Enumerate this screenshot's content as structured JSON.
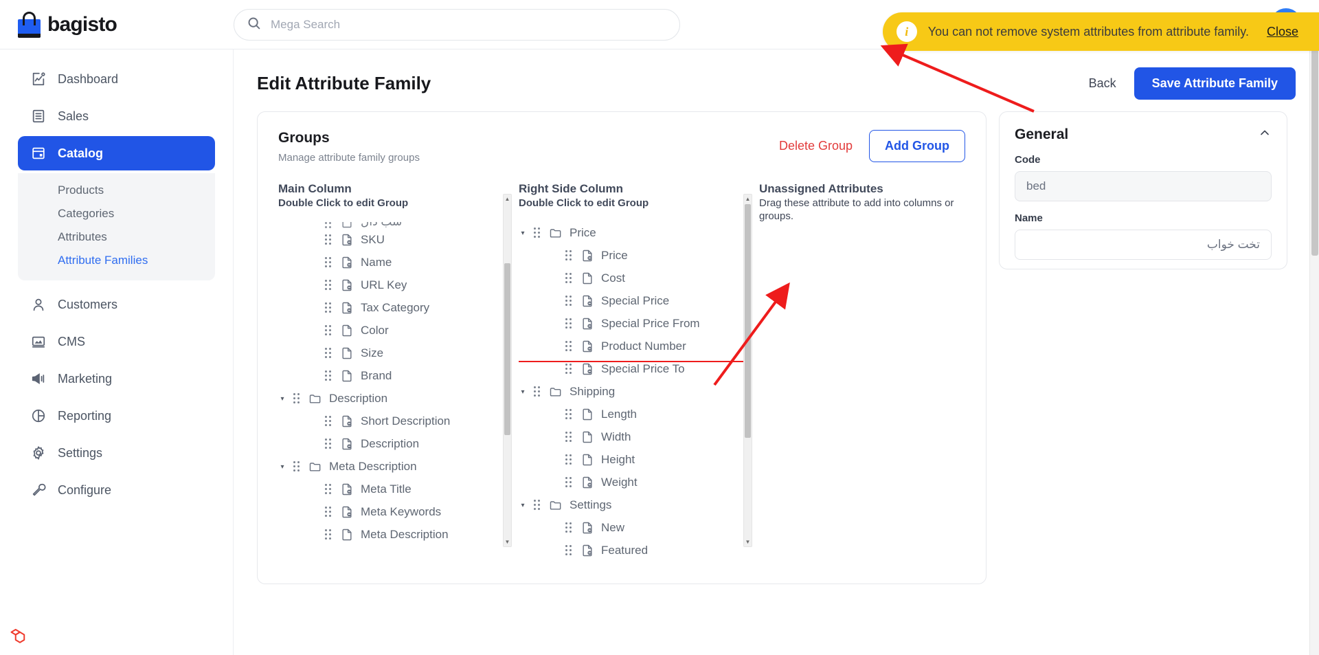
{
  "app": {
    "brand_name": "bagisto",
    "brand_color": "#1f5df1"
  },
  "search": {
    "placeholder": "Mega Search",
    "value": "",
    "icon": "search-icon"
  },
  "toast": {
    "icon": "info-icon",
    "message": "You can not remove system attributes from attribute family.",
    "close_label": "Close",
    "background": "#f7c916"
  },
  "sidebar": {
    "items": [
      {
        "label": "Dashboard",
        "icon": "dashboard-icon",
        "active": false
      },
      {
        "label": "Sales",
        "icon": "sales-icon",
        "active": false
      },
      {
        "label": "Catalog",
        "icon": "catalog-icon",
        "active": true
      },
      {
        "label": "Customers",
        "icon": "customers-icon",
        "active": false
      },
      {
        "label": "CMS",
        "icon": "cms-icon",
        "active": false
      },
      {
        "label": "Marketing",
        "icon": "marketing-icon",
        "active": false
      },
      {
        "label": "Reporting",
        "icon": "reporting-icon",
        "active": false
      },
      {
        "label": "Settings",
        "icon": "gear-icon",
        "active": false
      },
      {
        "label": "Configure",
        "icon": "wrench-icon",
        "active": false
      }
    ],
    "catalog_subitems": [
      {
        "label": "Products",
        "current": false
      },
      {
        "label": "Categories",
        "current": false
      },
      {
        "label": "Attributes",
        "current": false
      },
      {
        "label": "Attribute Families",
        "current": true
      }
    ]
  },
  "page": {
    "title": "Edit Attribute Family",
    "back_label": "Back",
    "save_label": "Save Attribute Family"
  },
  "groups": {
    "title": "Groups",
    "subtitle": "Manage attribute family groups",
    "delete_label": "Delete Group",
    "add_label": "Add Group"
  },
  "main_column": {
    "title": "Main Column",
    "hint": "Double Click to edit Group",
    "rows": [
      {
        "label": "سب دال",
        "type": "attribute",
        "indent": 1,
        "icon": "file-icon",
        "rtl": true,
        "clipped": true
      },
      {
        "label": "SKU",
        "type": "attribute",
        "indent": 1,
        "icon": "file-system-icon"
      },
      {
        "label": "Name",
        "type": "attribute",
        "indent": 1,
        "icon": "file-system-icon"
      },
      {
        "label": "URL Key",
        "type": "attribute",
        "indent": 1,
        "icon": "file-system-icon"
      },
      {
        "label": "Tax Category",
        "type": "attribute",
        "indent": 1,
        "icon": "file-system-icon"
      },
      {
        "label": "Color",
        "type": "attribute",
        "indent": 1,
        "icon": "file-icon"
      },
      {
        "label": "Size",
        "type": "attribute",
        "indent": 1,
        "icon": "file-icon"
      },
      {
        "label": "Brand",
        "type": "attribute",
        "indent": 1,
        "icon": "file-icon"
      },
      {
        "label": "Description",
        "type": "group",
        "indent": 0,
        "icon": "folder-icon",
        "expanded": true
      },
      {
        "label": "Short Description",
        "type": "attribute",
        "indent": 1,
        "icon": "file-system-icon"
      },
      {
        "label": "Description",
        "type": "attribute",
        "indent": 1,
        "icon": "file-system-icon"
      },
      {
        "label": "Meta Description",
        "type": "group",
        "indent": 0,
        "icon": "folder-icon",
        "expanded": true
      },
      {
        "label": "Meta Title",
        "type": "attribute",
        "indent": 1,
        "icon": "file-system-icon"
      },
      {
        "label": "Meta Keywords",
        "type": "attribute",
        "indent": 1,
        "icon": "file-system-icon"
      },
      {
        "label": "Meta Description",
        "type": "attribute",
        "indent": 1,
        "icon": "file-icon"
      }
    ]
  },
  "right_column": {
    "title": "Right Side Column",
    "hint": "Double Click to edit Group",
    "rows": [
      {
        "label": "Price",
        "type": "group",
        "indent": 0,
        "icon": "folder-icon",
        "expanded": true
      },
      {
        "label": "Price",
        "type": "attribute",
        "indent": 1,
        "icon": "file-system-icon"
      },
      {
        "label": "Cost",
        "type": "attribute",
        "indent": 1,
        "icon": "file-icon"
      },
      {
        "label": "Special Price",
        "type": "attribute",
        "indent": 1,
        "icon": "file-system-icon"
      },
      {
        "label": "Special Price From",
        "type": "attribute",
        "indent": 1,
        "icon": "file-system-icon"
      },
      {
        "label": "Product Number",
        "type": "attribute",
        "indent": 1,
        "icon": "file-system-icon",
        "highlighted": true
      },
      {
        "label": "Special Price To",
        "type": "attribute",
        "indent": 1,
        "icon": "file-system-icon"
      },
      {
        "label": "Shipping",
        "type": "group",
        "indent": 0,
        "icon": "folder-icon",
        "expanded": true
      },
      {
        "label": "Length",
        "type": "attribute",
        "indent": 1,
        "icon": "file-icon"
      },
      {
        "label": "Width",
        "type": "attribute",
        "indent": 1,
        "icon": "file-icon"
      },
      {
        "label": "Height",
        "type": "attribute",
        "indent": 1,
        "icon": "file-icon"
      },
      {
        "label": "Weight",
        "type": "attribute",
        "indent": 1,
        "icon": "file-system-icon"
      },
      {
        "label": "Settings",
        "type": "group",
        "indent": 0,
        "icon": "folder-icon",
        "expanded": true
      },
      {
        "label": "New",
        "type": "attribute",
        "indent": 1,
        "icon": "file-system-icon"
      },
      {
        "label": "Featured",
        "type": "attribute",
        "indent": 1,
        "icon": "file-system-icon"
      }
    ]
  },
  "unassigned": {
    "title": "Unassigned Attributes",
    "hint": "Drag these attribute to add into columns or groups.",
    "rows": []
  },
  "general": {
    "title": "General",
    "collapse_icon": "chevron-up-icon",
    "code": {
      "label": "Code",
      "value": "bed",
      "readonly": true
    },
    "name": {
      "label": "Name",
      "value": "تخت خواب",
      "rtl": true
    }
  }
}
